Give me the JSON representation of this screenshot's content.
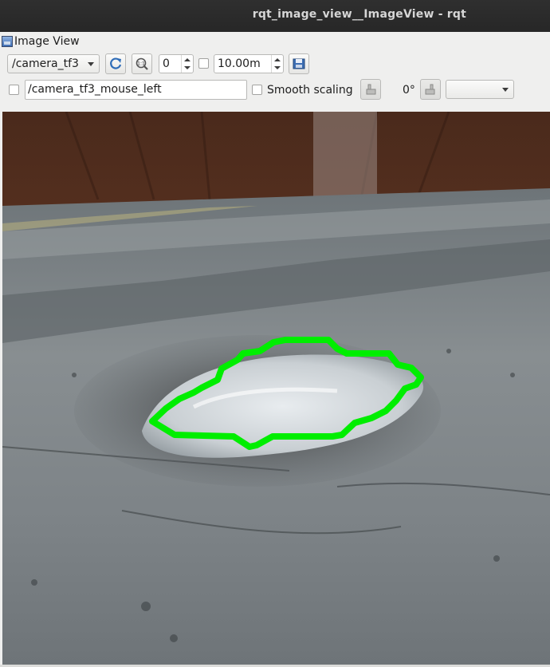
{
  "window": {
    "title": "rqt_image_view__ImageView - rqt"
  },
  "plugin": {
    "title": "Image View",
    "icon": "image-view-icon"
  },
  "toolbar": {
    "topic_select": {
      "value": "/camera_tf3",
      "icon": "chevron-down-icon"
    },
    "refresh_button": {
      "icon": "refresh-icon"
    },
    "zoom_button": {
      "icon": "zoom-original-icon"
    },
    "rotation_spin": {
      "value": "0"
    },
    "dynamic_range_checkbox": {
      "checked": false
    },
    "max_depth_spin": {
      "value": "10.00m"
    },
    "save_button": {
      "icon": "save-image-icon"
    }
  },
  "toolbar2": {
    "mouse_publish_checkbox": {
      "checked": false
    },
    "mouse_topic_field": {
      "value": "/camera_tf3_mouse_left"
    },
    "smooth_scaling": {
      "label": "Smooth scaling",
      "checked": false
    },
    "rotate_left_button": {
      "icon": "rotate-left-icon"
    },
    "rotation_label": "0°",
    "rotate_right_button": {
      "icon": "rotate-right-icon"
    },
    "extra_select": {
      "value": "",
      "icon": "chevron-down-icon"
    }
  },
  "image": {
    "content": "camera-feed-pothole",
    "detection_color": "#00ff00"
  }
}
